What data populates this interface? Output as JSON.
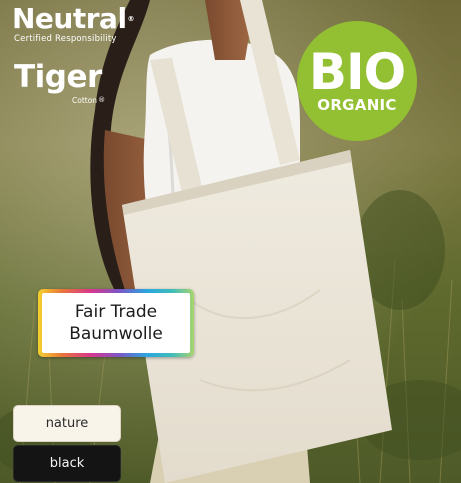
{
  "brand_neutral": {
    "name": "Neutral",
    "trademark": "®",
    "tagline": "Certified Responsibility"
  },
  "brand_tiger": {
    "name": "Tiger",
    "sub": "Cotton",
    "trademark": "®"
  },
  "bio_badge": {
    "title": "BIO",
    "subtitle": "ORGANIC",
    "color": "#93bf33"
  },
  "fairtrade_badge": {
    "line1": "Fair Trade",
    "line2": "Baumwolle"
  },
  "color_options": [
    {
      "label": "nature",
      "color": "#f8f4ea"
    },
    {
      "label": "black",
      "color": "#141414"
    }
  ]
}
